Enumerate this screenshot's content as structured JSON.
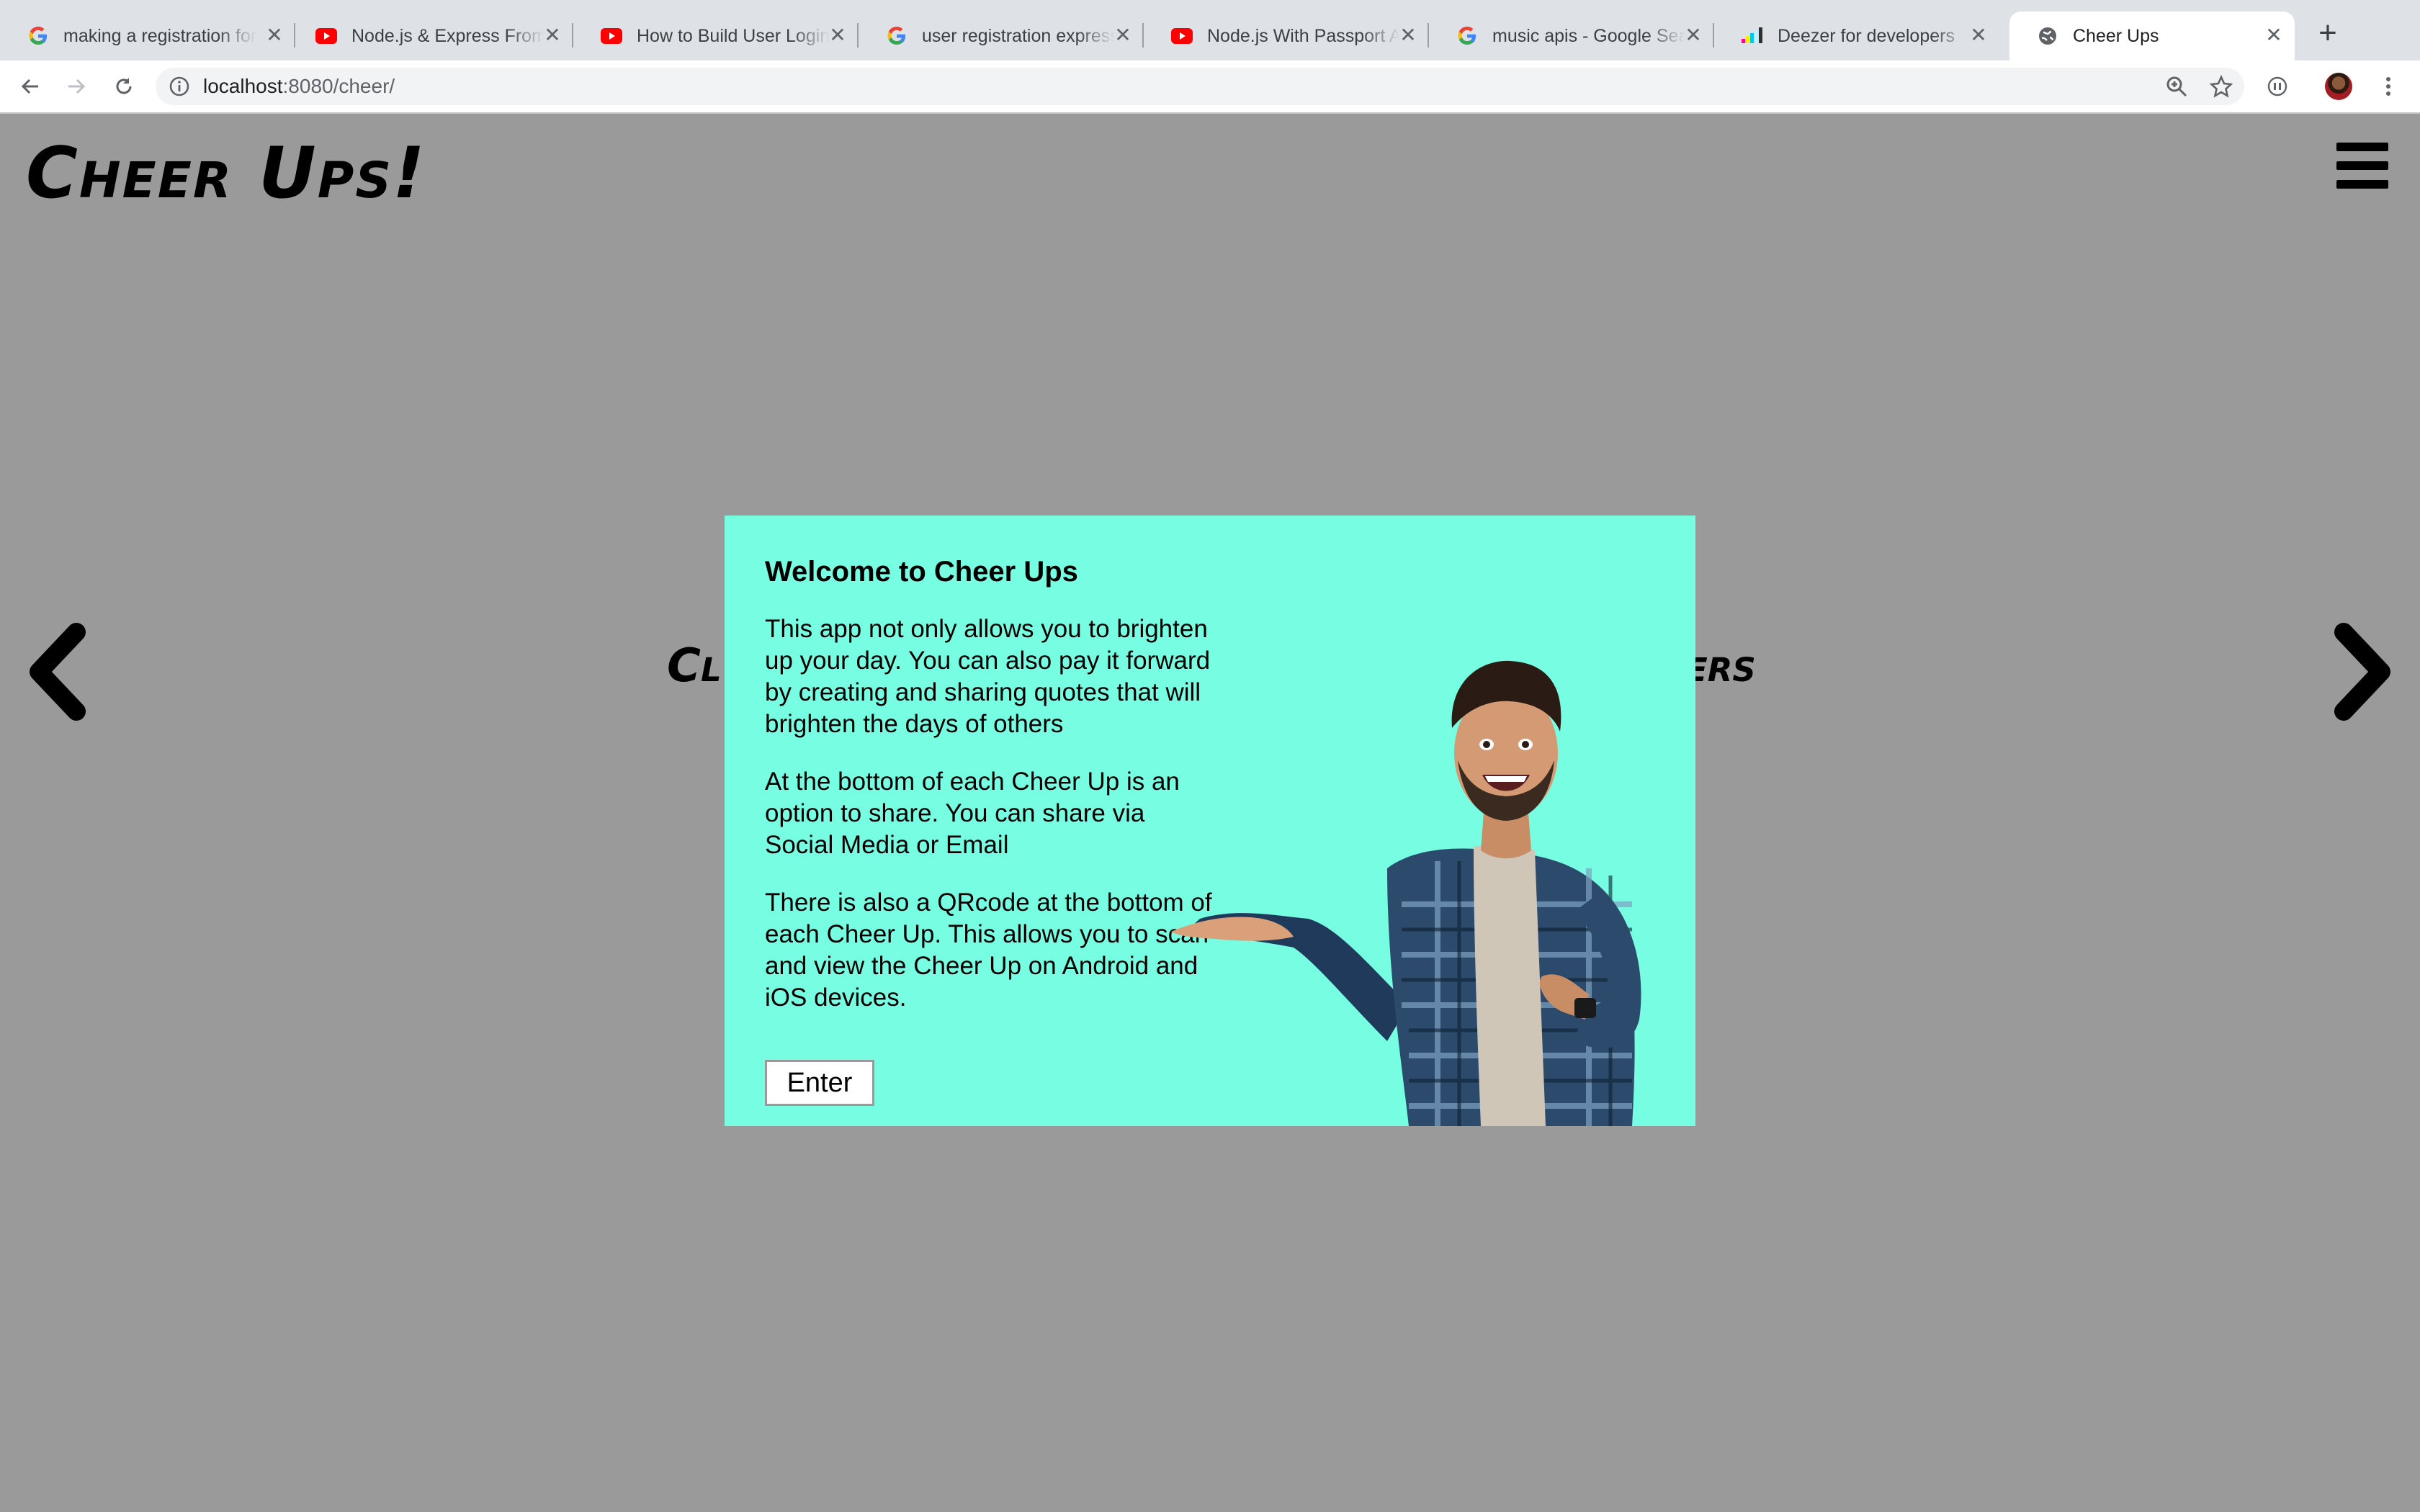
{
  "browser": {
    "tabs": [
      {
        "title": "making a registration form",
        "favicon": "google-icon",
        "active": false
      },
      {
        "title": "Node.js & Express From Scratch",
        "favicon": "youtube-icon",
        "active": false
      },
      {
        "title": "How to Build User Login",
        "favicon": "youtube-icon",
        "active": false
      },
      {
        "title": "user registration express",
        "favicon": "google-icon",
        "active": false
      },
      {
        "title": "Node.js With Passport Authentication",
        "favicon": "youtube-icon",
        "active": false
      },
      {
        "title": "music apis - Google Search",
        "favicon": "google-icon",
        "active": false
      },
      {
        "title": "Deezer for developers",
        "favicon": "deezer-icon",
        "active": false
      },
      {
        "title": "Cheer Ups",
        "favicon": "globe-icon",
        "active": true
      }
    ],
    "url_host": "localhost",
    "url_rest": ":8080/cheer/"
  },
  "page": {
    "logo": "Cheer Ups!",
    "behind_left": "Cl",
    "behind_right": "ers"
  },
  "modal": {
    "title": "Welcome to Cheer Ups",
    "paragraphs": [
      "This app not only allows you to brighten up your day. You can also pay it forward by creating and sharing quotes that will brighten the days of others",
      "At the bottom of each Cheer Up is an option to share. You can share via Social Media or Email",
      "There is also a QRcode at the bottom of each Cheer Up. This allows you to scan and view the Cheer Up on Android and iOS devices."
    ],
    "enter_label": "Enter"
  },
  "colors": {
    "modal_bg": "#77fde2",
    "page_bg": "#9a9a9a",
    "youtube_red": "#ff0000"
  }
}
